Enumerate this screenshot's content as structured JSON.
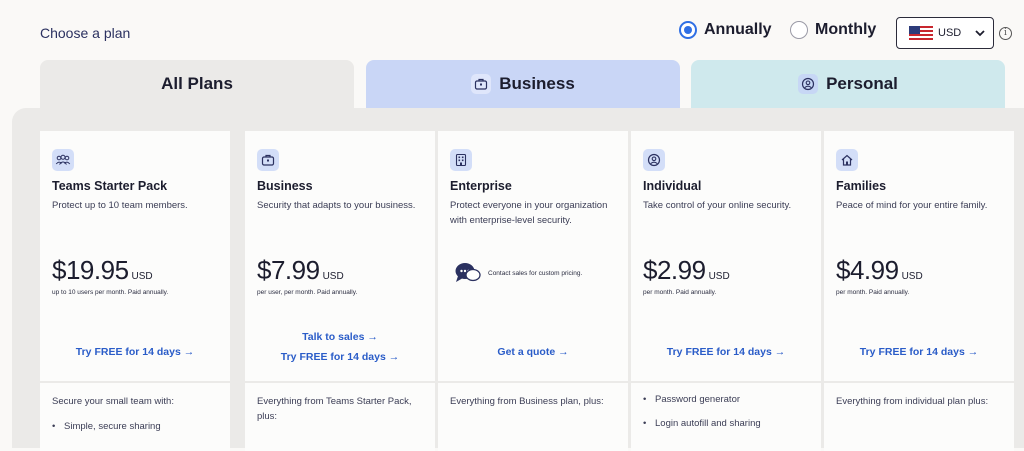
{
  "header": {
    "choose_label": "Choose a plan",
    "billing": {
      "annually_label": "Annually",
      "monthly_label": "Monthly",
      "selected": "Annually"
    },
    "currency": {
      "value": "USD",
      "flag_icon": "us-flag-icon"
    }
  },
  "tabs": [
    {
      "label": "All Plans",
      "active": true
    },
    {
      "label": "Business",
      "icon": "briefcase-icon"
    },
    {
      "label": "Personal",
      "icon": "user-circle-icon"
    }
  ],
  "plans": [
    {
      "name": "Teams Starter Pack",
      "icon": "team-icon",
      "description": "Protect up to 10 team members.",
      "price": "$19.95",
      "currency": "USD",
      "price_note": "up to 10 users per month. Paid annually.",
      "cta": "Try FREE for 14 days",
      "features_intro": "Secure your small team with:",
      "bullets": [
        "Simple, secure sharing"
      ]
    },
    {
      "name": "Business",
      "icon": "briefcase-icon",
      "description": "Security that adapts to your business.",
      "price": "$7.99",
      "currency": "USD",
      "price_note": "per user, per month. Paid annually.",
      "secondary_cta": "Talk to sales",
      "cta": "Try FREE for 14 days",
      "features_intro": "Everything from Teams Starter Pack, plus:"
    },
    {
      "name": "Enterprise",
      "icon": "building-icon",
      "description": "Protect everyone in your organization with enterprise-level security.",
      "contact_note": "Contact sales for custom pricing.",
      "contact_icon": "chat-bubbles-icon",
      "cta": "Get a quote",
      "features_intro": "Everything from Business plan, plus:"
    },
    {
      "name": "Individual",
      "icon": "user-circle-icon",
      "description": "Take control of your online security.",
      "price": "$2.99",
      "currency": "USD",
      "price_note": "per month. Paid annually.",
      "cta": "Try FREE for 14 days",
      "bullets": [
        "Password generator",
        "Login autofill and sharing"
      ]
    },
    {
      "name": "Families",
      "icon": "home-icon",
      "description": "Peace of mind for your entire family.",
      "price": "$4.99",
      "currency": "USD",
      "price_note": "per month. Paid annually.",
      "cta": "Try FREE for 14 days",
      "features_intro": "Everything from individual plan plus:"
    }
  ],
  "arrow_glyph": "→",
  "colors": {
    "accent": "#2f6fe4",
    "link": "#2a5cc8",
    "business_tab": "#c9d6f6",
    "personal_tab": "#cfe9ed"
  }
}
